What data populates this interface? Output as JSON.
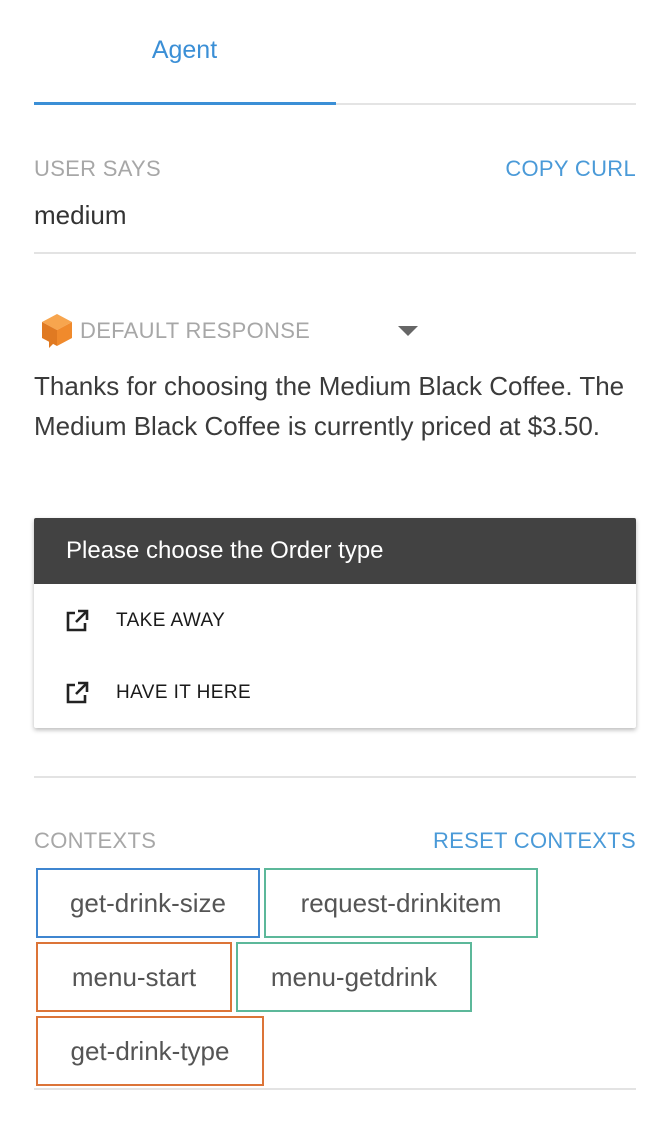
{
  "tabs": [
    {
      "label": "Agent",
      "active": true
    }
  ],
  "user_says": {
    "label": "USER SAYS",
    "copy_curl": "COPY CURL",
    "value": "medium"
  },
  "default_response": {
    "label": "DEFAULT RESPONSE",
    "text": "Thanks for choosing the Medium Black Coffee. The Medium Black Coffee is currently priced at $3.50."
  },
  "card": {
    "title": "Please choose the Order type",
    "buttons": [
      {
        "label": "TAKE AWAY",
        "icon": "external-link-icon"
      },
      {
        "label": "HAVE IT HERE",
        "icon": "external-link-icon"
      }
    ]
  },
  "contexts": {
    "label": "CONTEXTS",
    "reset": "RESET CONTEXTS",
    "items": [
      {
        "name": "get-drink-size",
        "color": "#3f86d0"
      },
      {
        "name": "request-drinkitem",
        "color": "#5cb89a"
      },
      {
        "name": "menu-start",
        "color": "#dc7438"
      },
      {
        "name": "menu-getdrink",
        "color": "#5cb89a"
      },
      {
        "name": "get-drink-type",
        "color": "#dc7438"
      }
    ]
  },
  "colors": {
    "accent": "#3b8fd6",
    "card_header": "#424242",
    "icon_orange": "#f0892f"
  }
}
